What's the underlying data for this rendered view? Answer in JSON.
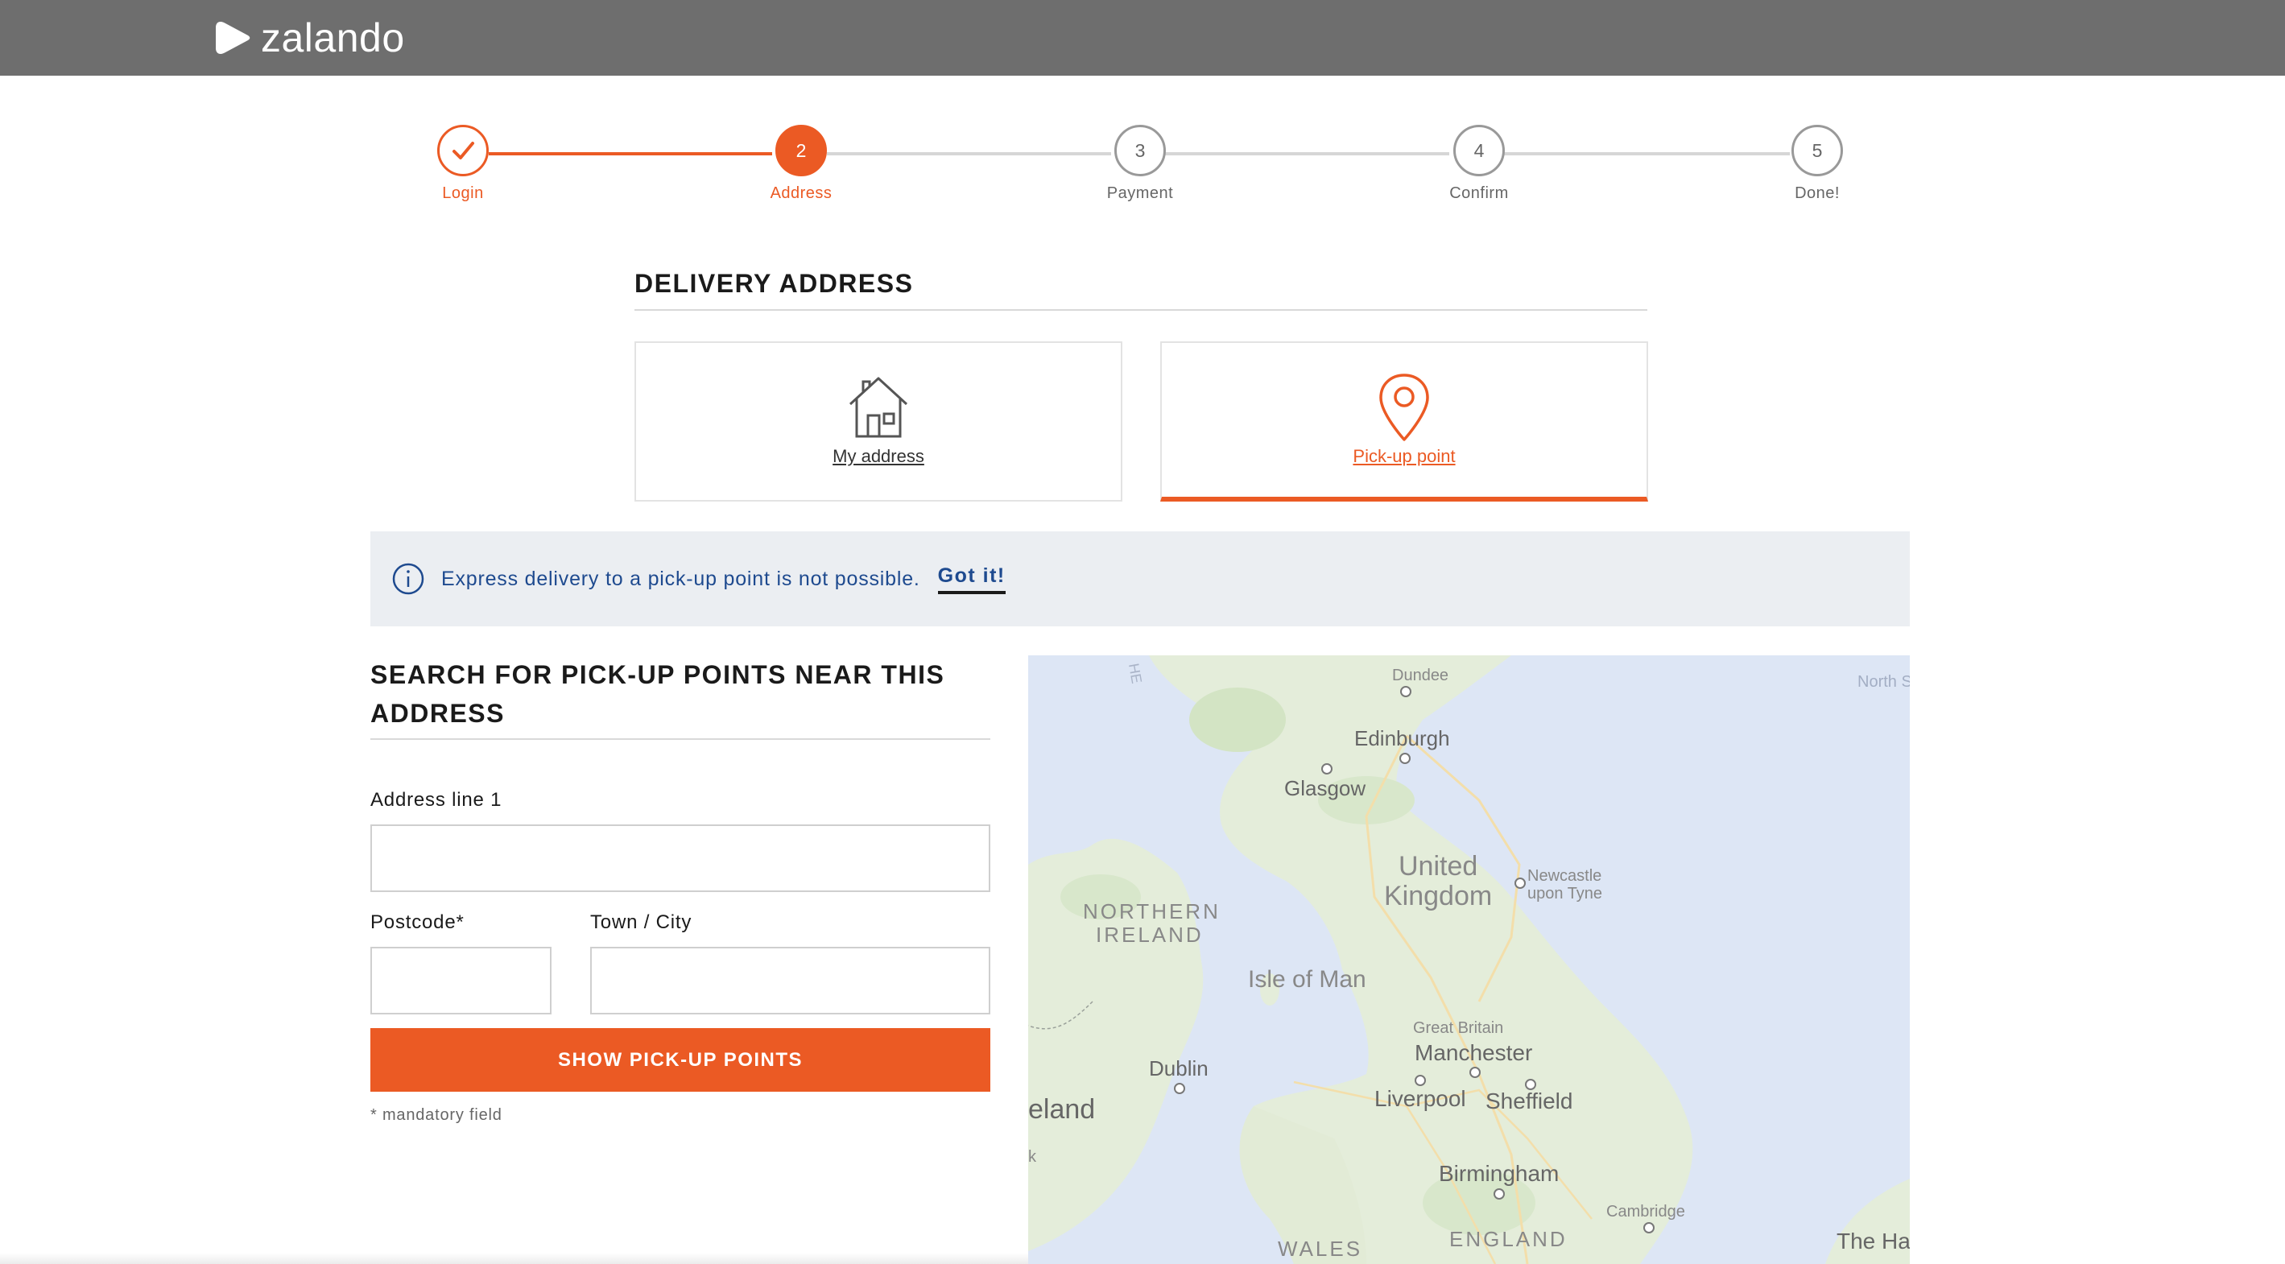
{
  "header": {
    "brand": "zalando",
    "logo_icon": "zalando-play-icon"
  },
  "stepper": {
    "steps": [
      {
        "number": "",
        "label": "Login",
        "state": "done"
      },
      {
        "number": "2",
        "label": "Address",
        "state": "active"
      },
      {
        "number": "3",
        "label": "Payment",
        "state": "pending"
      },
      {
        "number": "4",
        "label": "Confirm",
        "state": "pending"
      },
      {
        "number": "5",
        "label": "Done!",
        "state": "pending"
      }
    ]
  },
  "delivery": {
    "title": "DELIVERY ADDRESS",
    "options": [
      {
        "label": "My address",
        "icon": "house-icon",
        "selected": false
      },
      {
        "label": "Pick-up point",
        "icon": "location-pin-icon",
        "selected": true
      }
    ]
  },
  "info": {
    "icon": "info-icon",
    "message": "Express delivery to a pick-up point is not possible.",
    "action": "Got it!"
  },
  "search": {
    "title": "SEARCH FOR PICK-UP POINTS NEAR THIS ADDRESS",
    "address_label": "Address line 1",
    "address_value": "",
    "postcode_label": "Postcode*",
    "postcode_value": "",
    "town_label": "Town / City",
    "town_value": "",
    "button": "SHOW PICK-UP POINTS",
    "mandatory_note": "* mandatory field"
  },
  "map": {
    "labels": {
      "dundee": "Dundee",
      "north_sea": "North S",
      "edinburgh": "Edinburgh",
      "glasgow": "Glasgow",
      "united": "United",
      "kingdom": "Kingdom",
      "newcastle1": "Newcastle",
      "newcastle2": "upon Tyne",
      "northern": "NORTHERN",
      "ireland_ni": "IRELAND",
      "isle_of_man": "Isle of Man",
      "great_britain": "Great Britain",
      "manchester": "Manchester",
      "dublin": "Dublin",
      "ireland": "eland",
      "liverpool": "Liverpool",
      "sheffield": "Sheffield",
      "birmingham": "Birmingham",
      "cambridge": "Cambridge",
      "wales": "WALES",
      "england": "ENGLAND",
      "the_hague": "The Ha",
      "hebrides": "HE",
      "k": "k"
    }
  },
  "colors": {
    "accent": "#eb5a24",
    "header": "#6e6e6e",
    "info_bg": "#ebeef2",
    "info_text": "#1e4a8f"
  }
}
